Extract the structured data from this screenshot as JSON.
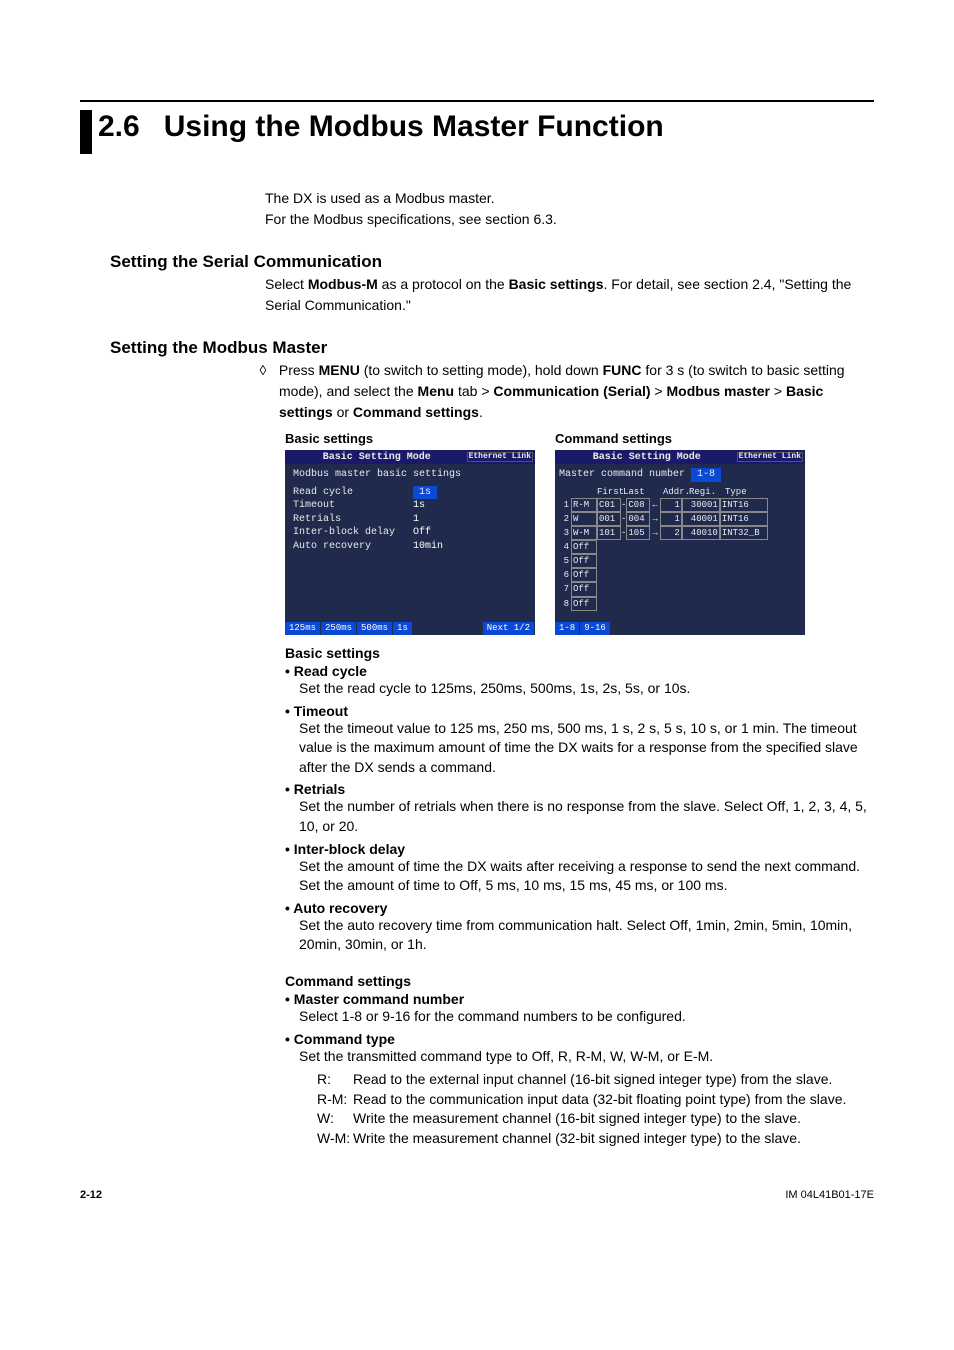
{
  "section": {
    "number": "2.6",
    "title": "Using the Modbus Master Function"
  },
  "intro": {
    "l1": "The DX is used as a Modbus master.",
    "l2": "For the Modbus specifications, see section 6.3."
  },
  "serial": {
    "heading": "Setting the Serial Communication",
    "body_parts": [
      "Select ",
      "Modbus-M",
      " as a protocol on the ",
      "Basic settings",
      ". For detail, see section 2.4, \"Setting the Serial Communication.\""
    ]
  },
  "master": {
    "heading": "Setting the Modbus Master",
    "proc_parts": [
      "Press ",
      "MENU",
      " (to switch to setting mode), hold down ",
      "FUNC",
      " for 3 s (to switch to basic setting mode), and select the ",
      "Menu",
      " tab > ",
      "Communication (Serial)",
      " > ",
      "Modbus master",
      " > ",
      "Basic settings",
      " or ",
      "Command settings",
      "."
    ]
  },
  "screens": {
    "basic_cap": "Basic settings",
    "command_cap": "Command settings",
    "titlebar": "Basic Setting Mode",
    "link": "Ethernet\nLink",
    "basic": {
      "header": "Modbus master basic settings",
      "rows": [
        {
          "lab": "Read cycle",
          "val": "1s",
          "hi": true
        },
        {
          "lab": "Timeout",
          "val": "1s"
        },
        {
          "lab": "Retrials",
          "val": "1"
        },
        {
          "lab": "Inter-block delay",
          "val": "Off"
        },
        {
          "lab": "Auto recovery",
          "val": "10min"
        }
      ],
      "footer": [
        "125ms",
        "250ms",
        "500ms",
        "1s"
      ],
      "footer_r": "Next 1/2"
    },
    "cmd": {
      "header_lab": "Master command number",
      "header_val": "1-8",
      "cols": [
        "",
        "First",
        "Last",
        "",
        "Addr.",
        "Regi.",
        "Type"
      ],
      "rows": [
        {
          "n": "1",
          "t": "R-M",
          "f": "C01",
          "l": "C08",
          "ar": "←",
          "a": "1",
          "r": "30001",
          "ty": "INT16"
        },
        {
          "n": "2",
          "t": "W",
          "f": "001",
          "l": "004",
          "ar": "→",
          "a": "1",
          "r": "40001",
          "ty": "INT16"
        },
        {
          "n": "3",
          "t": "W-M",
          "f": "101",
          "l": "105",
          "ar": "→",
          "a": "2",
          "r": "40010",
          "ty": "INT32_B"
        },
        {
          "n": "4",
          "t": "Off"
        },
        {
          "n": "5",
          "t": "Off"
        },
        {
          "n": "6",
          "t": "Off"
        },
        {
          "n": "7",
          "t": "Off"
        },
        {
          "n": "8",
          "t": "Off"
        }
      ],
      "footer": [
        "1-8",
        "9-16"
      ]
    }
  },
  "basic_settings": {
    "heading": "Basic settings",
    "items": [
      {
        "name": "Read cycle",
        "desc": "Set the read cycle to 125ms, 250ms, 500ms, 1s, 2s, 5s, or 10s."
      },
      {
        "name": "Timeout",
        "desc": "Set the timeout value to 125 ms, 250 ms, 500 ms, 1 s, 2 s, 5 s, 10 s, or 1 min. The timeout value is the maximum amount of time the DX waits for a response from the specified slave after the DX sends a command."
      },
      {
        "name": "Retrials",
        "desc": "Set the number of retrials when there is no response from the slave. Select Off, 1, 2, 3, 4, 5, 10, or 20."
      },
      {
        "name": "Inter-block delay",
        "desc": "Set the amount of time the DX waits after receiving a response to send the next command. Set the amount of time to Off, 5 ms, 10 ms, 15 ms, 45 ms, or 100 ms."
      },
      {
        "name": "Auto recovery",
        "desc": "Set the auto recovery time from communication halt. Select Off, 1min, 2min, 5min, 10min, 20min, 30min, or 1h."
      }
    ]
  },
  "cmd_settings": {
    "heading": "Command settings",
    "items": [
      {
        "name": "Master command number",
        "desc": "Select 1-8 or 9-16 for the command numbers to be configured."
      },
      {
        "name": "Command type",
        "desc": "Set the transmitted command type to Off, R, R-M, W, W-M, or E-M."
      }
    ],
    "types": [
      {
        "k": "R:",
        "d": "Read to the external input channel (16-bit signed integer type) from the slave."
      },
      {
        "k": "R-M:",
        "d": "Read to the communication input data (32-bit floating point type) from the slave."
      },
      {
        "k": "W:",
        "d": "Write the measurement channel (16-bit signed integer type) to the slave."
      },
      {
        "k": "W-M:",
        "d": "Write the measurement channel (32-bit signed integer type) to the slave."
      }
    ]
  },
  "footer": {
    "page": "2-12",
    "doc": "IM 04L41B01-17E"
  }
}
